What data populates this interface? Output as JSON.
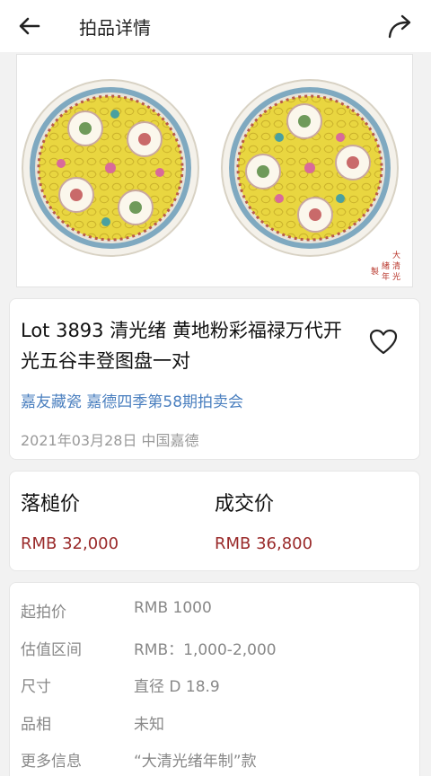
{
  "header": {
    "title": "拍品详情",
    "back_icon": "arrow-left-icon",
    "share_icon": "share-icon"
  },
  "image": {
    "description_icon": "porcelain-plates-image",
    "mark_text": "大清光緒年製"
  },
  "lot": {
    "title": "Lot 3893 清光绪  黄地粉彩福禄万代开光五谷丰登图盘一对",
    "auction": "嘉友藏瓷 嘉德四季第58期拍卖会",
    "date": "2021年03月28日 中国嘉德"
  },
  "prices": {
    "hammer_label": "落槌价",
    "hammer_value": "RMB 32,000",
    "deal_label": "成交价",
    "deal_value": "RMB 36,800"
  },
  "details": [
    {
      "key": "起拍价",
      "value": "RMB 1000"
    },
    {
      "key": "估值区间",
      "value": "RMB：1,000-2,000"
    },
    {
      "key": "尺寸",
      "value": "直径  D 18.9"
    },
    {
      "key": "品相",
      "value": "未知"
    },
    {
      "key": "更多信息",
      "value": "“大清光绪年制”款"
    }
  ],
  "colors": {
    "price": "#9a2a2a",
    "link": "#4a7fbf",
    "plate_yellow": "#e9d640"
  }
}
